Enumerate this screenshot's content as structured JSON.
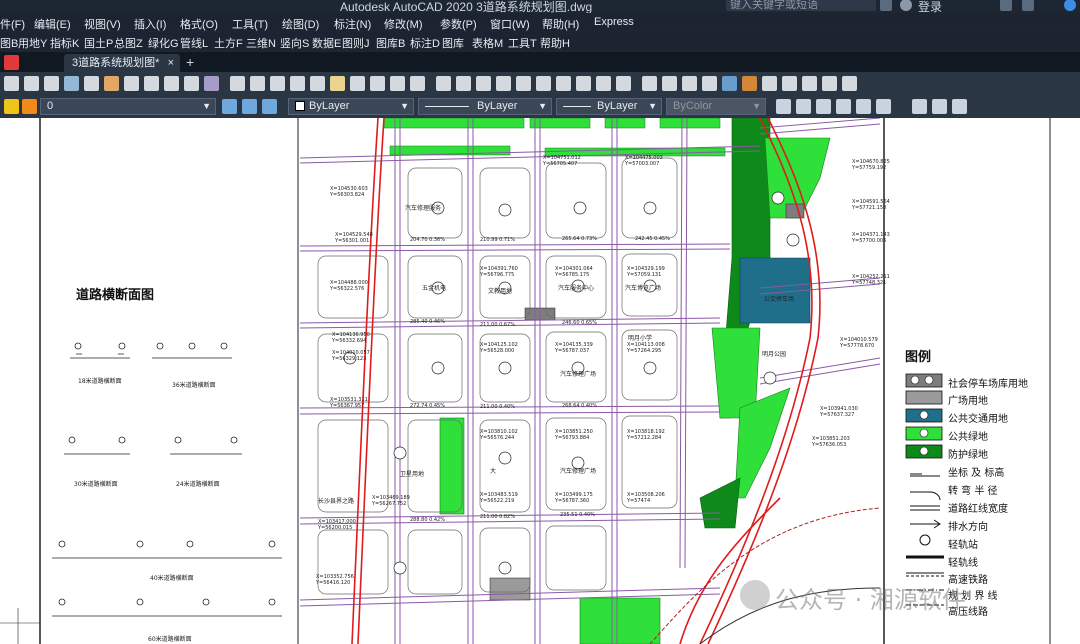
{
  "window": {
    "title": "Autodesk AutoCAD 2020    3道路系统规划图.dwg",
    "search_placeholder": "键入关键字或短语",
    "login": "登录"
  },
  "menu1": [
    "件(F)",
    "编辑(E)",
    "视图(V)",
    "插入(I)",
    "格式(O)",
    "工具(T)",
    "绘图(D)",
    "标注(N)",
    "修改(M)",
    "参数(P)",
    "窗口(W)",
    "帮助(H)",
    "Express"
  ],
  "menu2": [
    "图B",
    "用地Y",
    "指标K",
    "国土P",
    "总图Z",
    "绿化G",
    "管线L",
    "土方F",
    "三维N",
    "竖向S",
    "数据E",
    "图则J",
    "图库B",
    "标注D",
    "图库",
    "表格M",
    "工具T",
    "帮助H"
  ],
  "tab": {
    "label": "3道路系统规划图*",
    "close": "×",
    "add": "+"
  },
  "layer": {
    "name": "0"
  },
  "properties": {
    "color": "ByLayer",
    "linetype": "ByLayer",
    "lineweight": "ByLayer",
    "plotstyle": "ByColor"
  },
  "drawing": {
    "section_title": "道路横断面图",
    "cross_sections": [
      "18米道路横断面",
      "36米道路横断面",
      "30米道路横断面",
      "24米道路横断面",
      "40米道路横断面",
      "60米道路横断面"
    ],
    "legend_title": "图例",
    "legend": [
      {
        "label": "社会停车场库用地",
        "color": "#7d7d7d"
      },
      {
        "label": "广场用地",
        "color": "#9a9a9a"
      },
      {
        "label": "公共交通用地",
        "color": "#1f6f8b"
      },
      {
        "label": "公共绿地",
        "color": "#2fe03a"
      },
      {
        "label": "防护绿地",
        "color": "#0e8a1a"
      },
      {
        "label": "坐标 及 标高",
        "color": "#ffffff"
      },
      {
        "label": "转 弯 半 径",
        "color": "#ffffff"
      },
      {
        "label": "道路红线宽度",
        "color": "#ffffff"
      },
      {
        "label": "排水方向",
        "color": "#ffffff"
      },
      {
        "label": "轻轨站",
        "color": "#ffffff"
      },
      {
        "label": "轻轨线",
        "color": "#ffffff"
      },
      {
        "label": "高速铁路",
        "color": "#ffffff"
      },
      {
        "label": "规 划 界 线",
        "color": "#ffffff"
      },
      {
        "label": "高压线路",
        "color": "#ffffff"
      }
    ],
    "plan_labels": [
      "汽车修理服务",
      "五金机电",
      "文教用地",
      "明月公园",
      "公交停车场",
      "汽车服务中心",
      "汽车博览广场",
      "大",
      "汽车修理广场",
      "公交停车场",
      "明月小学"
    ],
    "watermark": "公众号 · 湘源软件"
  },
  "colors": {
    "road_red": "#e01b1b",
    "road_purple": "#8a5aa6",
    "green": "#2fe03a",
    "dark_green": "#0e8a1a",
    "ui_bg": "#2b3644"
  }
}
